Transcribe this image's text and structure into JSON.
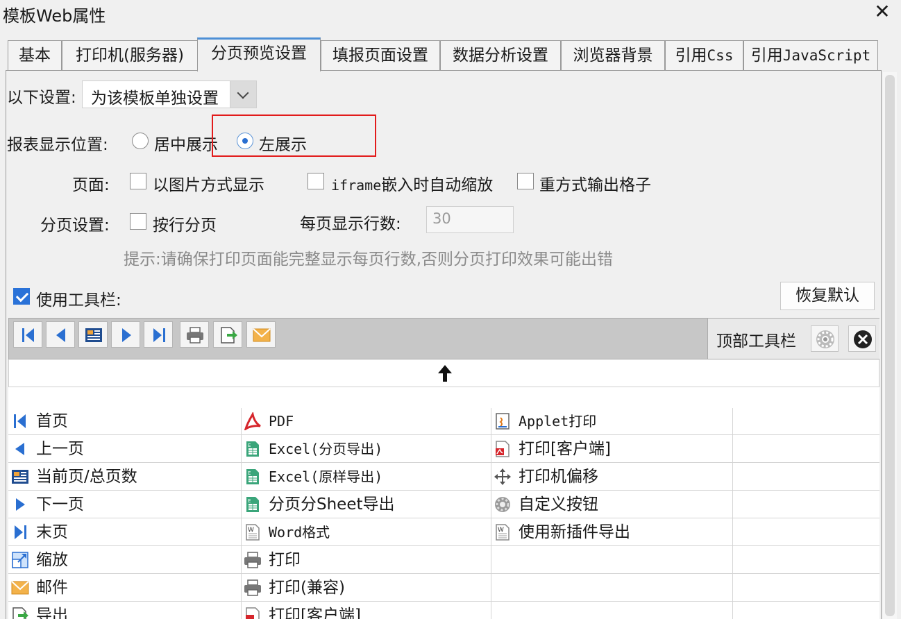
{
  "window": {
    "title": "模板Web属性",
    "close_glyph": "✕"
  },
  "tabs": [
    {
      "label": "基本"
    },
    {
      "label": "打印机(服务器)"
    },
    {
      "label": "分页预览设置",
      "active": true
    },
    {
      "label": "填报页面设置"
    },
    {
      "label": "数据分析设置"
    },
    {
      "label": "浏览器背景"
    },
    {
      "label_prefix": "引用",
      "label_mono": "Css"
    },
    {
      "label_prefix": "引用",
      "label_mono": "JavaScript"
    }
  ],
  "settings": {
    "scope_label": "以下设置:",
    "scope_value": "为该模板单独设置",
    "position_label": "报表显示位置:",
    "position_options": [
      {
        "label": "居中展示",
        "selected": false
      },
      {
        "label": "左展示",
        "selected": true
      }
    ],
    "page_label": "页面:",
    "page_options": [
      {
        "label": "以图片方式显示",
        "checked": false
      },
      {
        "label_mono": "iframe",
        "label": "嵌入时自动缩放",
        "checked": false
      },
      {
        "label": "重方式输出格子",
        "checked": false
      }
    ],
    "paging_label": "分页设置:",
    "paging_option": {
      "label": "按行分页",
      "checked": false
    },
    "rows_label": "每页显示行数:",
    "rows_value": "30",
    "hint": "提示:请确保打印页面能完整显示每页行数,否则分页打印效果可能出错"
  },
  "toolbar_section": {
    "use_toolbar_label": "使用工具栏:",
    "use_toolbar_checked": true,
    "restore_button": "恢复默认",
    "position_label": "顶部工具栏",
    "toolbar_icons": [
      "first-page-icon",
      "previous-page-icon",
      "page-number-icon",
      "next-page-icon",
      "last-page-icon",
      "print-icon",
      "export-icon",
      "email-icon"
    ],
    "drop_arrow": "up-arrow-icon"
  },
  "button_grid": [
    [
      "首页",
      "PDF",
      "Applet打印"
    ],
    [
      "上一页",
      "Excel(分页导出)",
      "打印[客户端]"
    ],
    [
      "当前页/总页数",
      "Excel(原样导出)",
      "打印机偏移"
    ],
    [
      "下一页",
      "分页分Sheet导出",
      "自定义按钮"
    ],
    [
      "末页",
      "Word格式",
      "使用新插件导出"
    ],
    [
      "缩放",
      "打印",
      ""
    ],
    [
      "邮件",
      "打印(兼容)",
      ""
    ],
    [
      "导出",
      "打印[客户端]",
      ""
    ]
  ],
  "colors": {
    "accent": "#2a72d8",
    "highlight_box": "#e21b1b",
    "tab_active_top": "#4d8fd6"
  }
}
